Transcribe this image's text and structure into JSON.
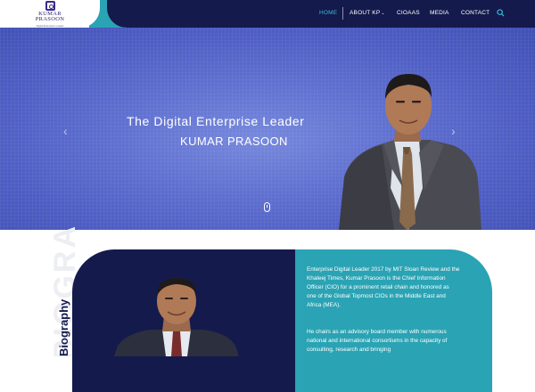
{
  "brand": {
    "name_line1": "KUMAR",
    "name_line2": "PRASOON",
    "tagline": "Digital Enterprise Leader"
  },
  "nav": {
    "items": [
      {
        "label": "HOME",
        "active": true
      },
      {
        "label": "ABOUT KP",
        "has_dropdown": true
      },
      {
        "label": "CIOAAS"
      },
      {
        "label": "MEDIA"
      },
      {
        "label": "CONTACT"
      }
    ],
    "search_icon": "search-icon"
  },
  "hero": {
    "tagline": "The Digital Enterprise Leader",
    "name": "KUMAR PRASOON",
    "prev_arrow": "‹",
    "next_arrow": "›"
  },
  "biography": {
    "watermark": "BIOGRAPHY",
    "heading": "Biography",
    "paragraph1": "Enterprise Digital Leader 2017 by MIT Sloan Review and the Khaleej Times, Kumar Prasoon is the Chief Information Officer (CIO) for a prominent retail chain and honored as one of the Global Topmost CIOs in the Middle East and Africa (MEA).",
    "paragraph2": "He chairs as an advisory board member with numerous national and international consortiums in the capacity of consulting, research and bringing"
  },
  "colors": {
    "navy": "#141a4c",
    "teal": "#2aa3b4",
    "active_nav": "#3bb8d6",
    "hero_blue": "#5f70d0"
  }
}
